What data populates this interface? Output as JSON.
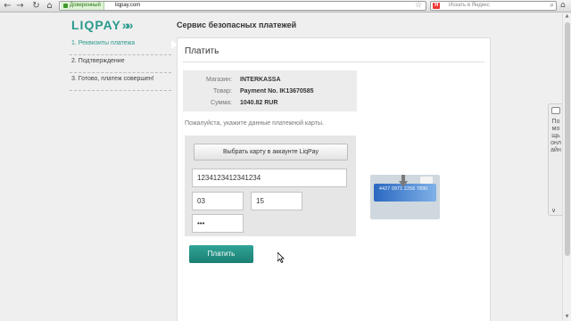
{
  "browser": {
    "trusted_label": "Доверенный",
    "url": "liqpay.com",
    "search_placeholder": "Искать в Яндекс",
    "search_logo": "Я"
  },
  "logo": {
    "text": "LIQPAY",
    "chevrons": "»»"
  },
  "header": {
    "title": "Сервис безопасных платежей"
  },
  "steps": [
    {
      "label": "1. Реквизиты платежа",
      "active": true
    },
    {
      "label": "2. Подтверждение",
      "active": false
    },
    {
      "label": "3. Готово, платеж совершен!",
      "active": false
    }
  ],
  "panel": {
    "title": "Платить",
    "info": [
      {
        "label": "Магазин:",
        "value": "INTERKASSA"
      },
      {
        "label": "Товар:",
        "value": "Payment No. IK13670585"
      },
      {
        "label": "Сумма:",
        "value": "1040.82 RUR"
      }
    ],
    "prompt": "Пожалуйста, укажите данные платежной карты.",
    "liqpay_card_button": "Выбрать карту в аккаунте LiqPay",
    "card_number": "1234123412341234",
    "exp_month": "03",
    "exp_year": "15",
    "cvv": "•••",
    "card_image_number": "4427 0971 2256 7890",
    "pay_button": "Платить"
  },
  "help": {
    "text": "Помощь онлайн",
    "chevron": "∨"
  },
  "colors": {
    "brand": "#2a9a8c",
    "trusted_green": "#3f9a27"
  }
}
